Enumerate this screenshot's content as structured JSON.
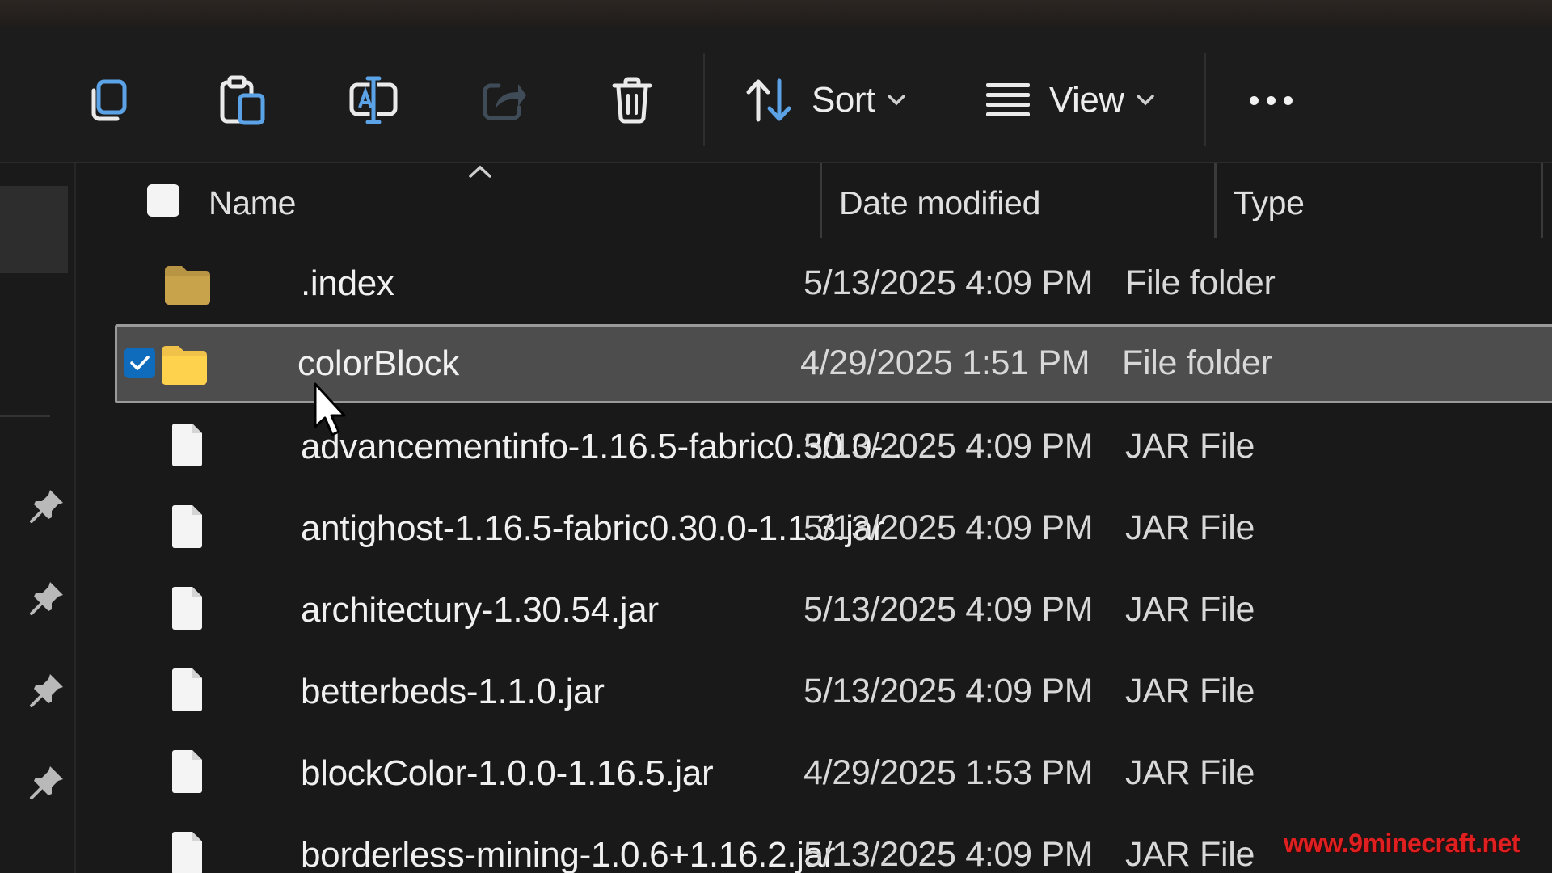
{
  "toolbar": {
    "buttons": [
      {
        "name": "copy",
        "icon": "copy-icon"
      },
      {
        "name": "paste",
        "icon": "paste-icon"
      },
      {
        "name": "rename",
        "icon": "rename-icon"
      },
      {
        "name": "share",
        "icon": "share-icon"
      },
      {
        "name": "delete",
        "icon": "trash-icon"
      }
    ],
    "sort_label": "Sort",
    "view_label": "View",
    "more_icon": "more-icon"
  },
  "columns": {
    "name": "Name",
    "date_modified": "Date modified",
    "type": "Type"
  },
  "rows": [
    {
      "name": ".index",
      "date": "5/13/2025 4:09 PM",
      "type": "File folder",
      "kind": "folder",
      "selected": false
    },
    {
      "name": "colorBlock",
      "date": "4/29/2025 1:51 PM",
      "type": "File folder",
      "kind": "folder",
      "selected": true
    },
    {
      "name": "advancementinfo-1.16.5-fabric0.30.0-...",
      "date": "5/13/2025 4:09 PM",
      "type": "JAR File",
      "kind": "file",
      "selected": false
    },
    {
      "name": "antighost-1.16.5-fabric0.30.0-1.1.3.jar",
      "date": "5/13/2025 4:09 PM",
      "type": "JAR File",
      "kind": "file",
      "selected": false
    },
    {
      "name": "architectury-1.30.54.jar",
      "date": "5/13/2025 4:09 PM",
      "type": "JAR File",
      "kind": "file",
      "selected": false
    },
    {
      "name": "betterbeds-1.1.0.jar",
      "date": "5/13/2025 4:09 PM",
      "type": "JAR File",
      "kind": "file",
      "selected": false
    },
    {
      "name": "blockColor-1.0.0-1.16.5.jar",
      "date": "4/29/2025 1:53 PM",
      "type": "JAR File",
      "kind": "file",
      "selected": false
    },
    {
      "name": "borderless-mining-1.0.6+1.16.2.jar",
      "date": "5/13/2025 4:09 PM",
      "type": "JAR File",
      "kind": "file",
      "selected": false
    }
  ],
  "colors": {
    "accent": "#0f6cbd",
    "folder": "#f0c24a",
    "selected_row": "#4d4d4d"
  },
  "watermark": "www.9minecraft.net"
}
